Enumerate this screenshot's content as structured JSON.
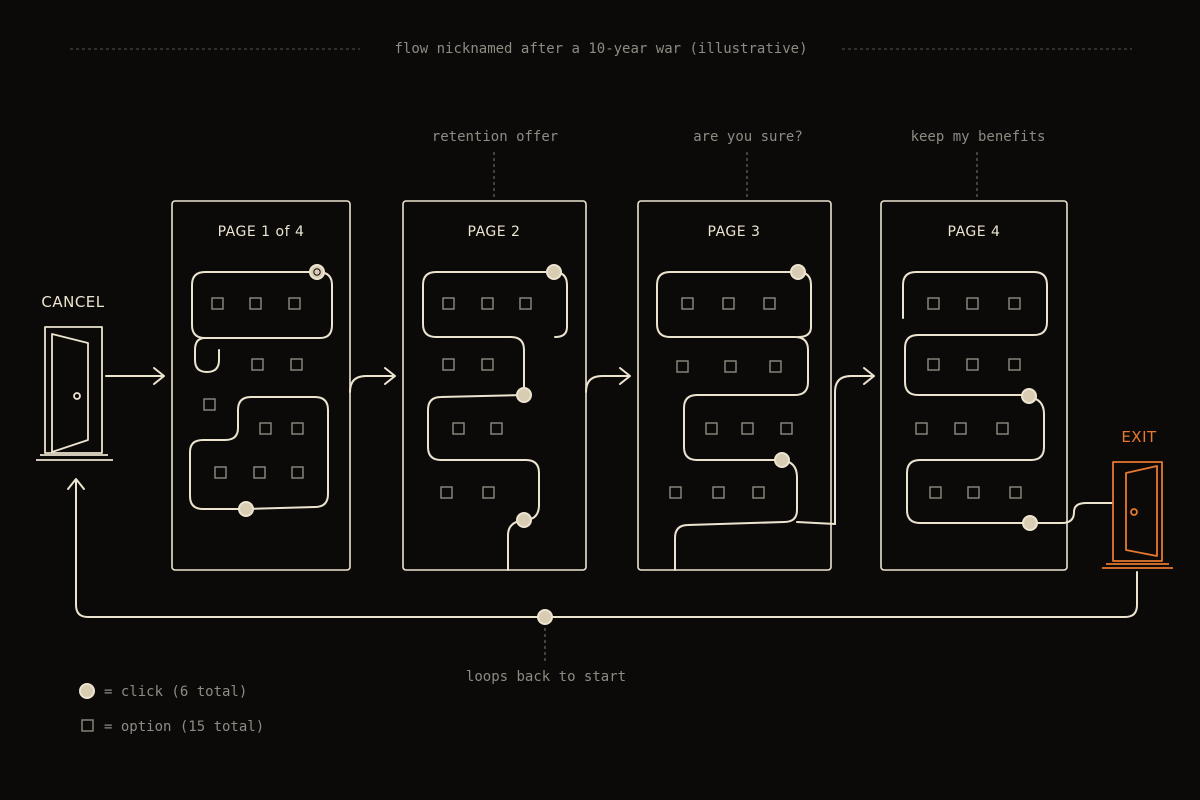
{
  "title": "flow nicknamed after a 10-year war (illustrative)",
  "colors": {
    "background": "#0b0a09",
    "line": "#ece4cf",
    "muted": "#8f8a82",
    "exit": "#e8782e",
    "dot_fill": "#d8cdb3"
  },
  "start": {
    "label": "CANCEL",
    "icon": "door-icon"
  },
  "exit": {
    "label": "EXIT",
    "icon": "door-open-icon"
  },
  "pages": [
    {
      "label": "PAGE 1 of 4",
      "annotation": ""
    },
    {
      "label": "PAGE 2",
      "annotation": "retention offer"
    },
    {
      "label": "PAGE 3",
      "annotation": "are you sure?"
    },
    {
      "label": "PAGE 4",
      "annotation": "keep my benefits"
    }
  ],
  "loop_label": "loops back to start",
  "legend": {
    "click": "= click (6 total)",
    "option": "= option (15 total)"
  }
}
